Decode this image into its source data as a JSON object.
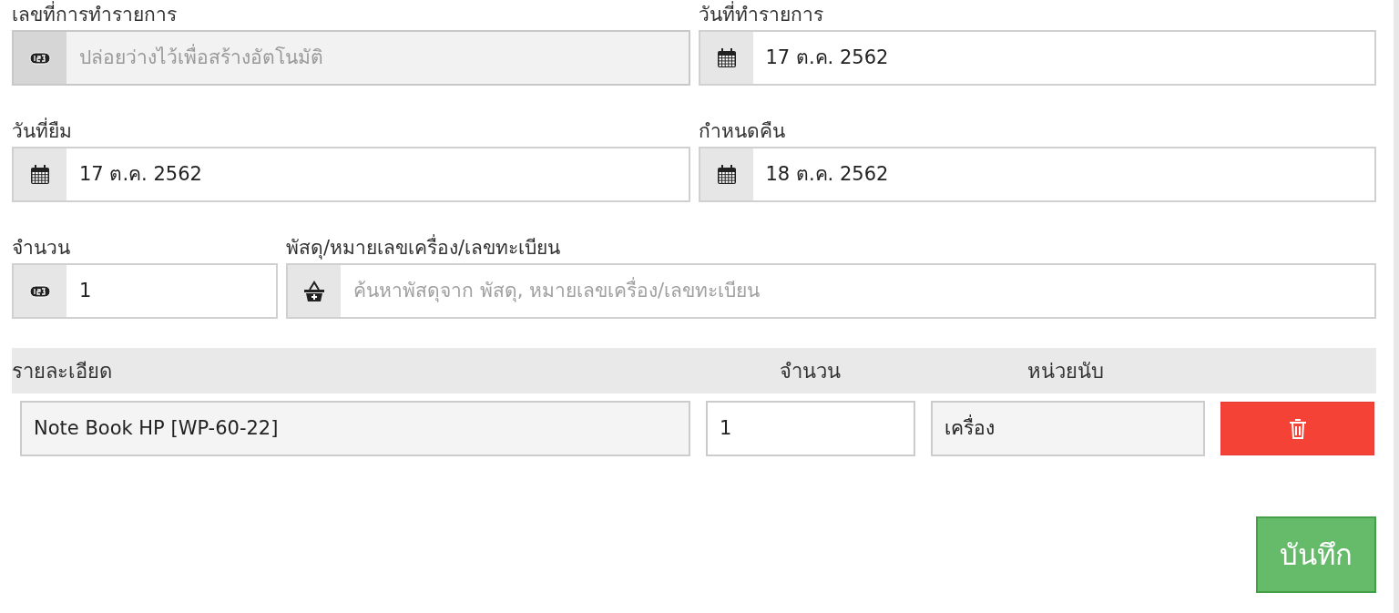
{
  "rows": [
    {
      "fields": [
        {
          "label": "เลขที่การทำรายการ",
          "kind": "number",
          "placeholder": "ปล่อยว่างไว้เพื่อสร้างอัตโนมัติ",
          "disabled": true
        },
        {
          "label": "วันที่ทำรายการ",
          "kind": "date",
          "value": "17 ต.ค. 2562",
          "disabled": false
        }
      ]
    },
    {
      "fields": [
        {
          "label": "วันที่ยืม",
          "kind": "date",
          "value": "17 ต.ค. 2562",
          "disabled": false
        },
        {
          "label": "กำหนดคืน",
          "kind": "date",
          "value": "18 ต.ค. 2562",
          "disabled": false
        }
      ]
    },
    {
      "fields": [
        {
          "label": "จำนวน",
          "kind": "number",
          "value": "1",
          "disabled": false
        },
        {
          "label": "พัสดุ/หมายเลขเครื่อง/เลขทะเบียน",
          "kind": "search",
          "placeholder": "ค้นหาพัสดุจาก พัสดุ, หมายเลขเครื่อง/เลขทะเบียน",
          "disabled": false
        }
      ]
    }
  ],
  "table": {
    "columns": [
      "รายละเอียด",
      "จำนวน",
      "หน่วยนับ"
    ],
    "rows": [
      {
        "detail": "Note Book HP [WP-60-22]",
        "quantity": "1",
        "unit": "เครื่อง"
      }
    ]
  },
  "save_button": "บันทึก"
}
